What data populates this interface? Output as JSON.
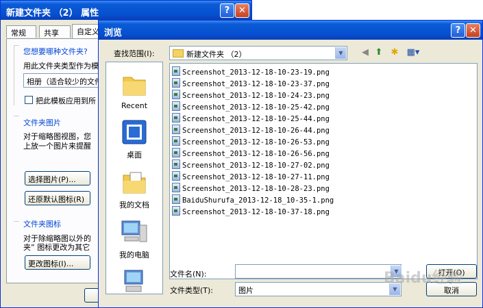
{
  "props_dialog": {
    "title": "新建文件夹 （2） 属性",
    "tabs": [
      "常规",
      "共享",
      "自定义"
    ],
    "group1_header": "您想要哪种文件夹?",
    "group1_text": "用此文件夹类型作为模",
    "template_value": "相册（适合较少的文件",
    "apply_checkbox_label": "把此模板应用到所",
    "group2_header": "文件夹图片",
    "group2_text_1": "对于缩略图视图，您",
    "group2_text_2": "上放一个图片来提醒",
    "choose_picture_button": "选择图片(P)...",
    "restore_default_button": "还原默认图标(R)",
    "group3_header": "文件夹图标",
    "group3_text_1": "对于除缩略图以外的",
    "group3_text_2": "夹” 图标更改为其它",
    "change_icon_button": "更改图标(I)..."
  },
  "browse_dialog": {
    "title": "浏览",
    "look_in_label": "查找范围(I):",
    "look_in_value": "新建文件夹 （2）",
    "places": [
      {
        "label": "Recent",
        "icon": "recent-folder-icon"
      },
      {
        "label": "桌面",
        "icon": "desktop-icon"
      },
      {
        "label": "我的文档",
        "icon": "my-documents-icon"
      },
      {
        "label": "我的电脑",
        "icon": "my-computer-icon"
      },
      {
        "label": "",
        "icon": "network-icon"
      }
    ],
    "files": [
      "Screenshot_2013-12-18-10-23-19.png",
      "Screenshot_2013-12-18-10-23-37.png",
      "Screenshot_2013-12-18-10-24-23.png",
      "Screenshot_2013-12-18-10-25-42.png",
      "Screenshot_2013-12-18-10-25-44.png",
      "Screenshot_2013-12-18-10-26-44.png",
      "Screenshot_2013-12-18-10-26-53.png",
      "Screenshot_2013-12-18-10-26-56.png",
      "Screenshot_2013-12-18-10-27-02.png",
      "Screenshot_2013-12-18-10-27-11.png",
      "Screenshot_2013-12-18-10-28-23.png",
      "BaiduShurufa_2013-12-18_10-35-1.png",
      "Screenshot_2013-12-18-10-37-18.png"
    ],
    "filename_label": "文件名(N):",
    "filename_value": "",
    "filetype_label": "文件类型(T):",
    "filetype_value": "图片",
    "open_button": "打开(O)",
    "cancel_button": "取消"
  },
  "watermark": "Baidu经验",
  "colors": {
    "titlebar": "#0650d0",
    "dialog_bg": "#ece9d8",
    "group_header": "#0046d5"
  }
}
